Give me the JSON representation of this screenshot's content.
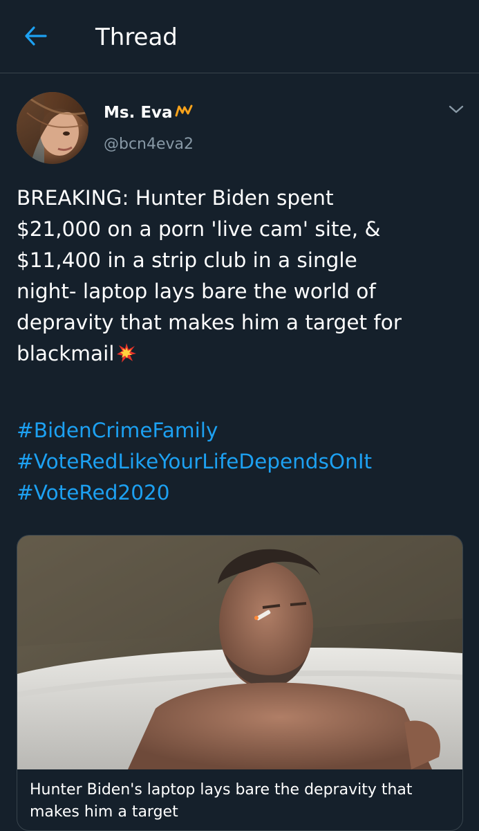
{
  "header": {
    "title": "Thread",
    "back_icon": "arrow-left-icon",
    "accent_color": "#1da1f2"
  },
  "tweet": {
    "author": {
      "display_name": "Ms. Eva",
      "name_emoji": "m-crown-icon",
      "handle": "@bcn4eva2"
    },
    "menu_icon": "chevron-down-icon",
    "text": "BREAKING: Hunter Biden spent\n$21,000 on a porn 'live cam' site, &\n$11,400 in a strip club in a single\nnight- laptop lays bare the world of\ndepravity that makes him a target for\nblackmail",
    "text_emoji": "collision-icon",
    "hashtags": [
      "#BidenCrimeFamily",
      "#VoteRedLikeYourLifeDependsOnIt",
      "#VoteRed2020"
    ],
    "card": {
      "caption": "Hunter Biden's laptop lays bare the depravity that makes him a target"
    }
  },
  "colors": {
    "background": "#15202b",
    "text": "#ffffff",
    "secondary_text": "#8899a6",
    "divider": "#38444d",
    "link": "#1da1f2"
  }
}
